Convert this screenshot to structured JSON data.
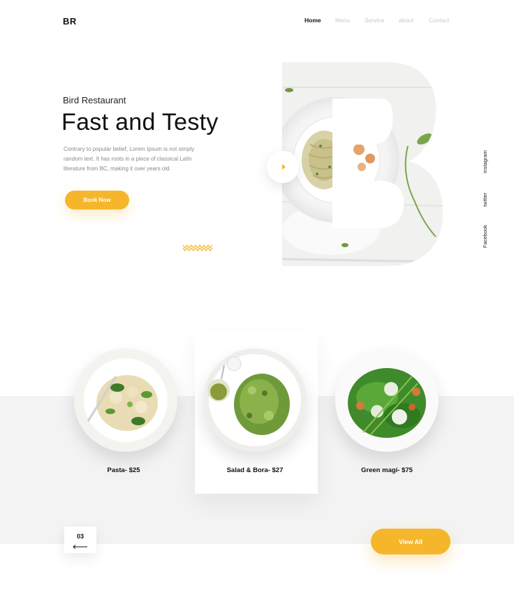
{
  "brand": {
    "logo": "BR"
  },
  "nav": {
    "items": [
      {
        "label": "Home",
        "active": true
      },
      {
        "label": "Menu",
        "active": false
      },
      {
        "label": "Service",
        "active": false
      },
      {
        "label": "about",
        "active": false
      },
      {
        "label": "Contact",
        "active": false
      }
    ]
  },
  "hero": {
    "subtitle": "Bird Restaurant",
    "title": "Fast and Testy",
    "description": "Contrary to popular belief, Lorem Ipsum is not simply random text. It has roots in a piece of classical Latin literature from BC, making it over years old.",
    "cta_label": "Book Now",
    "image_letter": "B",
    "play_icon": "play-icon"
  },
  "social": [
    "instagram",
    "twitter",
    "Facebook"
  ],
  "menu": {
    "dishes": [
      {
        "label": "Pasta- $25",
        "featured": false
      },
      {
        "label": "Salad & Bora- $27",
        "featured": true
      },
      {
        "label": "Green magi- $75",
        "featured": false
      }
    ],
    "pager": {
      "page": "03",
      "icon": "arrow-left-icon"
    },
    "view_all_label": "View All"
  },
  "colors": {
    "accent": "#f6b62b",
    "band": "#f3f3f3",
    "text": "#111111",
    "muted": "#8a8a8a",
    "nav_inactive": "#c9c9c9"
  }
}
